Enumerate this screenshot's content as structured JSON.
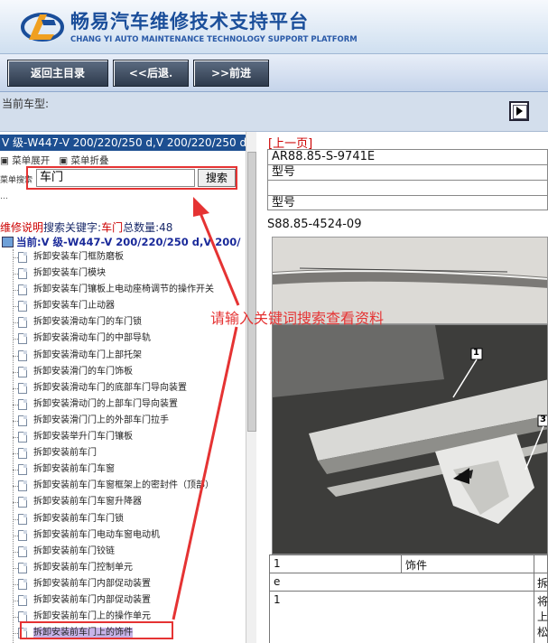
{
  "header": {
    "title_cn": "畅易汽车维修技术支持平台",
    "title_en": "CHANG YI AUTO MAINTENANCE TECHNOLOGY SUPPORT PLATFORM"
  },
  "toolbar": {
    "home": "返回主目录",
    "back": "<<后退.",
    "forward": ">>前进"
  },
  "vehicle_label": "当前车型:",
  "left": {
    "model": "V 级-W447-V 200/220/250 d,V 200/220/250 d",
    "expand_all": "菜单展开",
    "collapse_all": "菜单折叠",
    "search_label": "菜单搜索",
    "search_value": "车门",
    "search_button": "搜索",
    "dots": "…",
    "result_prefix": "维修说明",
    "result_kw_label": "搜索关键字:",
    "result_kw": "车门",
    "result_count_label": "总数量:",
    "result_count": "48",
    "current": "当前:V 级-W447-V 200/220/250 d,V 200/",
    "items": [
      "拆卸安装车门框防磨板",
      "拆卸安装车门模块",
      "拆卸安装车门镶板上电动座椅调节的操作开关",
      "拆卸安装车门止动器",
      "拆卸安装滑动车门的车门锁",
      "拆卸安装滑动车门的中部导轨",
      "拆卸安装滑动车门上部托架",
      "拆卸安装滑门的车门饰板",
      "拆卸安装滑动车门的底部车门导向装置",
      "拆卸安装滑动门的上部车门导向装置",
      "拆卸安装滑门门上的外部车门拉手",
      "拆卸安装举升门车门镶板",
      "拆卸安装前车门",
      "拆卸安装前车门车窗",
      "拆卸安装前车门车窗框架上的密封件（顶部）",
      "拆卸安装前车门车窗升降器",
      "拆卸安装前车门车门锁",
      "拆卸安装前车门电动车窗电动机",
      "拆卸安装前车门铰链",
      "拆卸安装前车门控制单元",
      "拆卸安装前车门内部促动装置",
      "拆卸安装前车门内部促动装置",
      "拆卸安装前车门上的操作单元",
      "拆卸安装前车门上的饰件"
    ]
  },
  "right": {
    "prev_page": "[上一页]",
    "part_no_1": "AR88.85-S-9741E",
    "model_label_1": "型号",
    "model_label_2": "型号",
    "part_no_2": "S88.85-4524-09",
    "callout_1": "1",
    "callout_3": "3",
    "table": {
      "r1c1": "1",
      "r1c2": "饰件",
      "r2c1": "e",
      "r2c3": "拆",
      "r3c1": "1",
      "r3c3a": "将",
      "r3c3b": "上",
      "r3c3c": "松"
    }
  },
  "annotation": "请输入关键词搜索查看资料",
  "colors": {
    "accent_red": "#e53333",
    "header_blue": "#1a4e9a",
    "model_bar": "#1d4f91"
  }
}
